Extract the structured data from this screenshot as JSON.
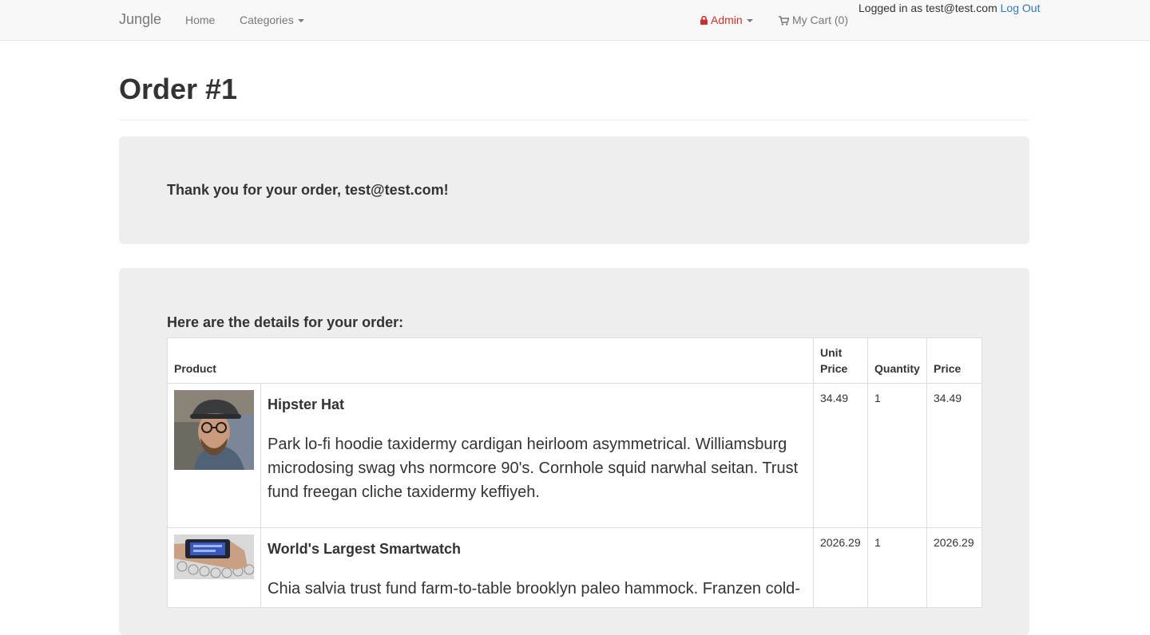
{
  "nav": {
    "brand": "Jungle",
    "home": "Home",
    "categories": "Categories",
    "admin": "Admin",
    "cart": "My Cart (0)",
    "logged_in_text": "Logged in as test@test.com",
    "logout": "Log Out"
  },
  "page": {
    "title": "Order #1",
    "thanks": "Thank you for your order, test@test.com!",
    "details_heading": "Here are the details for your order:"
  },
  "table": {
    "headers": {
      "product": "Product",
      "unit_price": "Unit Price",
      "quantity": "Quantity",
      "price": "Price"
    },
    "rows": [
      {
        "name": "Hipster Hat",
        "description": "Park lo-fi hoodie taxidermy cardigan heirloom asymmetrical. Williamsburg microdosing swag vhs normcore 90's. Cornhole squid narwhal seitan. Trust fund freegan cliche taxidermy keffiyeh.",
        "unit_price": "34.49",
        "quantity": "1",
        "price": "34.49"
      },
      {
        "name": "World's Largest Smartwatch",
        "description": "Chia salvia trust fund farm-to-table brooklyn paleo hammock. Franzen cold-",
        "unit_price": "2026.29",
        "quantity": "1",
        "price": "2026.29"
      }
    ]
  },
  "colors": {
    "navbar_bg": "#f8f8f8",
    "admin": "#c9302c",
    "link": "#337ab7",
    "well_bg": "#eeeeee"
  }
}
